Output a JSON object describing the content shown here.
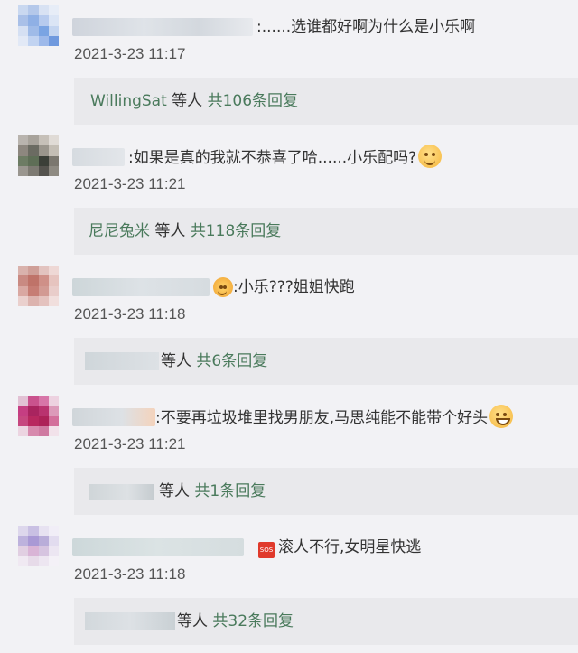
{
  "comments": [
    {
      "text": "......选谁都好啊为什么是小乐啊",
      "time": "2021-3-23 11:17",
      "reply": {
        "user": "WillingSat",
        "mid": " 等人 ",
        "count": "共106条回复"
      },
      "icon": ""
    },
    {
      "text": "如果是真的我就不恭喜了哈......小乐配吗?",
      "time": "2021-3-23 11:21",
      "reply": {
        "user": "尼尼兔米",
        "mid": " 等人 ",
        "count": "共118条回复"
      },
      "icon": "grinning-emoji-icon"
    },
    {
      "text": "小乐???姐姐快跑",
      "time": "2021-3-23 11:18",
      "reply": {
        "user": "",
        "mid": "等人 ",
        "count": "共6条回复"
      },
      "icon": "heart-eyes-emoji-icon"
    },
    {
      "text": "不要再垃圾堆里找男朋友,马思纯能不能带个好头",
      "time": "2021-3-23 11:21",
      "reply": {
        "user": "",
        "mid": "等人 ",
        "count": "共1条回复"
      },
      "icon": "grin-emoji-icon"
    },
    {
      "text": "滚人不行,女明星快逃",
      "time": "2021-3-23 11:18",
      "reply": {
        "user": "",
        "mid": "等人 ",
        "count": "共32条回复"
      },
      "icon": "sos-icon",
      "sos_label": "SOS"
    }
  ],
  "colon": ":"
}
